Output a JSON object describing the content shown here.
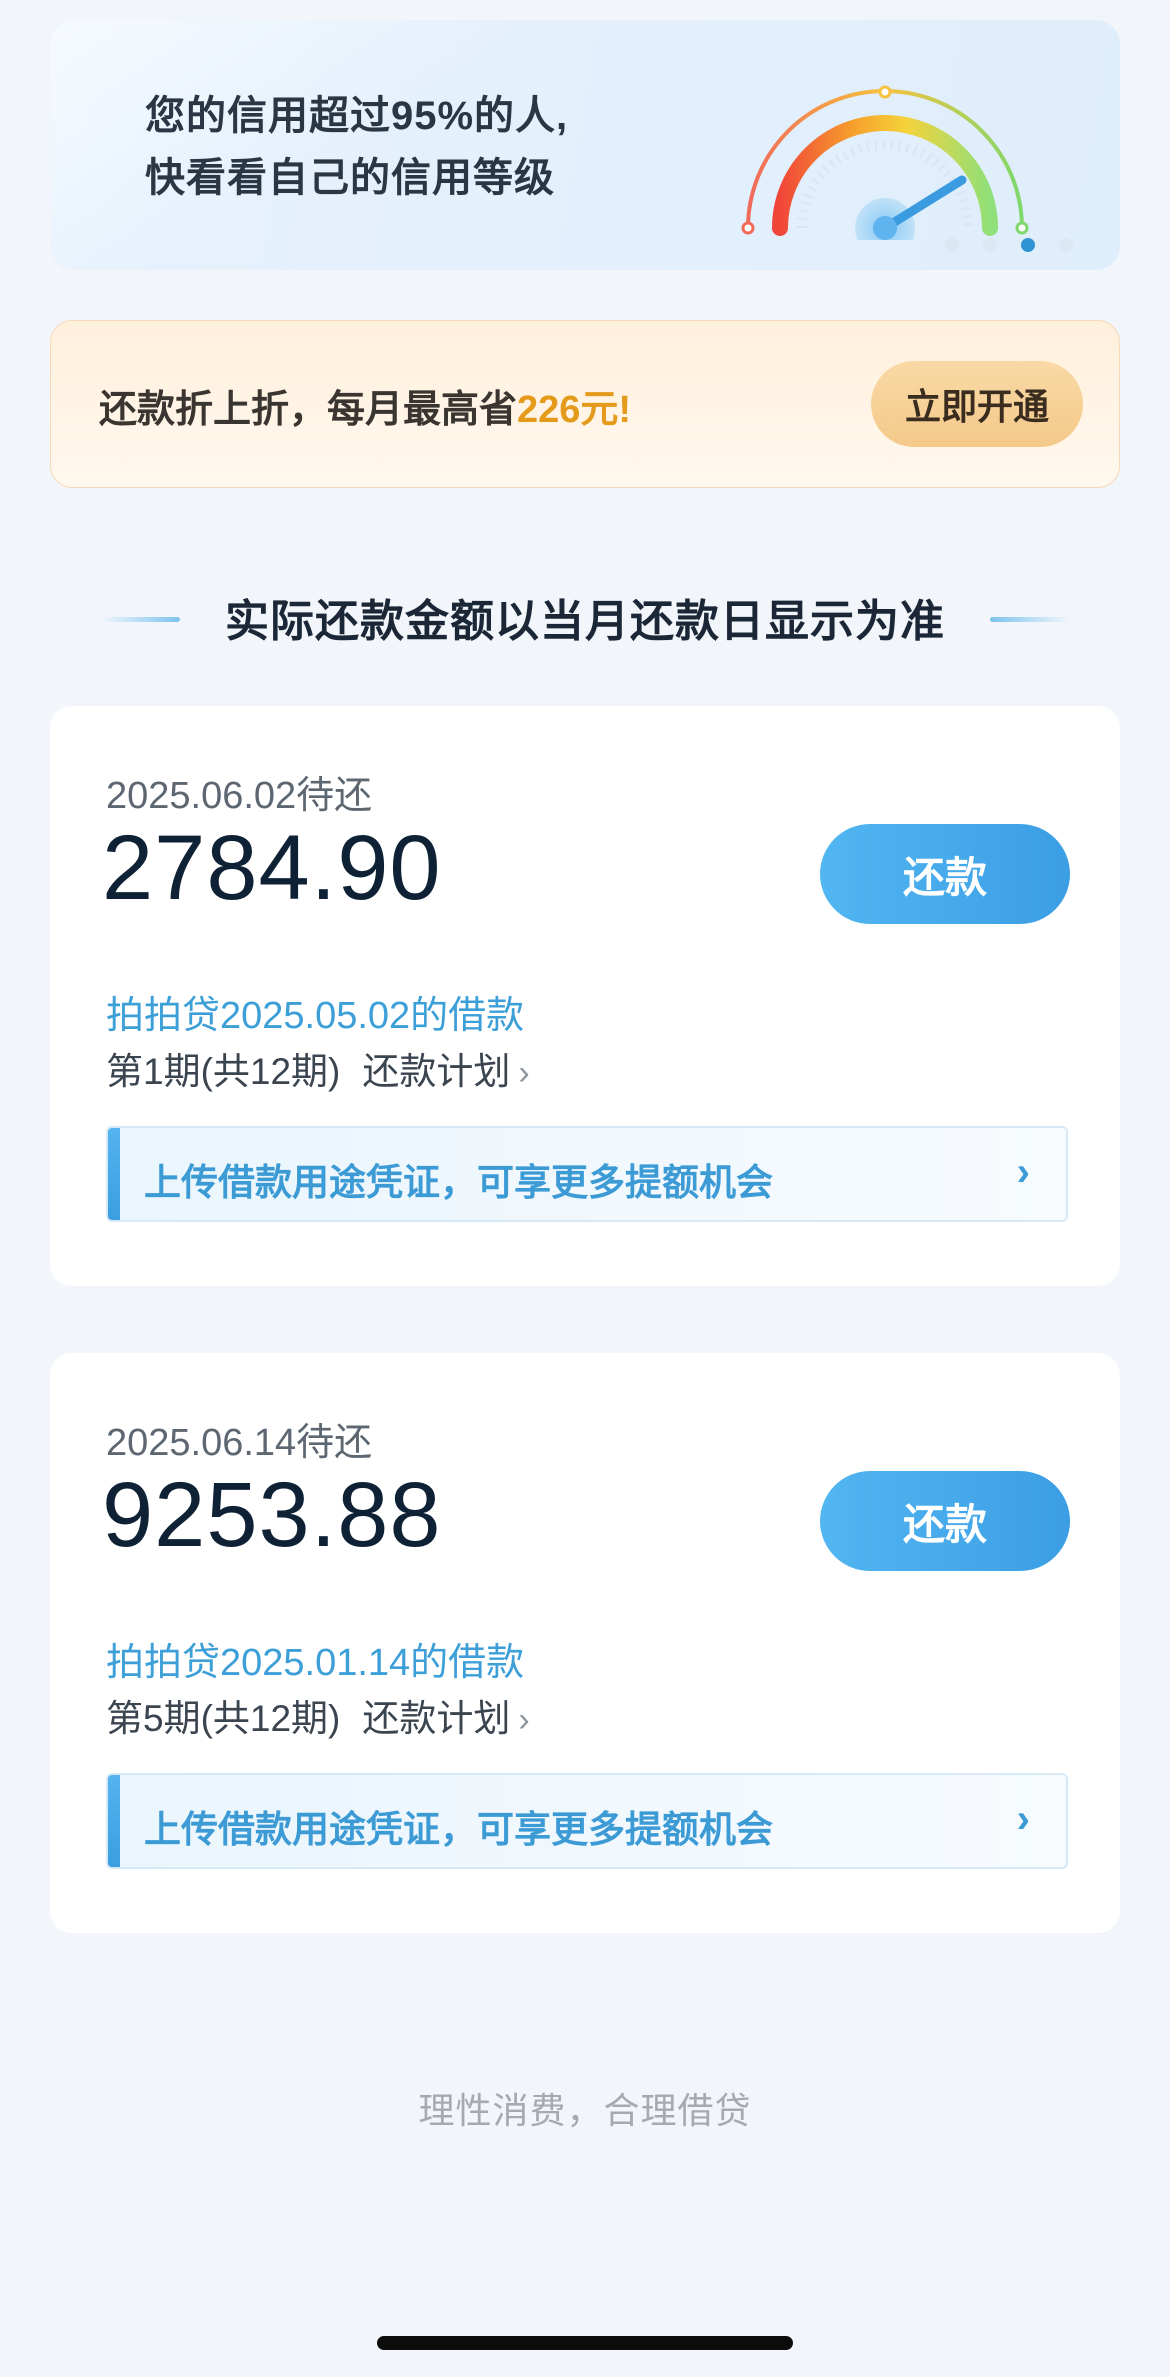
{
  "banner": {
    "line1": "您的信用超过95%的人,",
    "line2": "快看看自己的信用等级",
    "carousel_active_index": 2,
    "carousel_count": 4
  },
  "promo": {
    "text_prefix": "还款折上折，每月最高省",
    "text_highlight": "226元!",
    "button_label": "立即开通",
    "highlight_color": "#e49a1b"
  },
  "section": {
    "title": "实际还款金额以当月还款日显示为准"
  },
  "bills": [
    {
      "due": "2025.06.02待还",
      "amount": "2784.90",
      "pay_label": "还款",
      "loan": "拍拍贷2025.05.02的借款",
      "period": "第1期(共12期)",
      "plan_label": "还款计划",
      "upload_text": "上传借款用途凭证，可享更多提额机会"
    },
    {
      "due": "2025.06.14待还",
      "amount": "9253.88",
      "pay_label": "还款",
      "loan": "拍拍贷2025.01.14的借款",
      "period": "第5期(共12期)",
      "plan_label": "还款计划",
      "upload_text": "上传借款用途凭证，可享更多提额机会"
    }
  ],
  "footer": {
    "slogan": "理性消费，合理借贷"
  },
  "colors": {
    "accent": "#3b9ee4",
    "link": "#3d9fd8"
  }
}
